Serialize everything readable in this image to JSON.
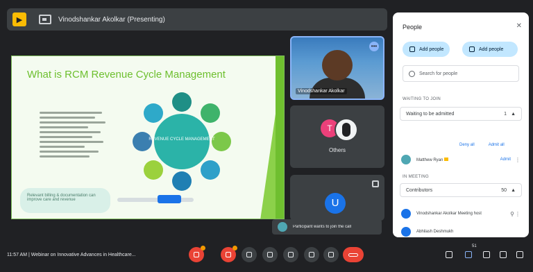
{
  "header": {
    "presenter": "Vinodshankar Akolkar (Presenting)"
  },
  "slide": {
    "title": "What is RCM Revenue Cycle Management",
    "center_label": "REVENUE CYCLE MANAGEMENT",
    "callout_text": "Relevant billing & documentation can improve care and revenue"
  },
  "tiles": {
    "video_name": "Vinodshankar Akolkar",
    "group_label": "Others",
    "avatar_letter_a": "T",
    "avatar_letter_u": "U"
  },
  "toast": {
    "text": "Participant wants to join the call"
  },
  "panel": {
    "title": "People",
    "add_people": "Add people",
    "add_people2": "Add people",
    "search_placeholder": "Search for people",
    "waiting_label": "WAITING TO JOIN",
    "waiting_dropdown": "Waiting to be admitted",
    "waiting_count": "1",
    "deny_all": "Deny all",
    "admit_all": "Admit all",
    "waiting_person": "Matthew Ryan",
    "admit_label": "Admit",
    "in_meeting_label": "IN MEETING",
    "contributors_dropdown": "Contributors",
    "contributors_count": "50",
    "person_1": "Vinodshankar Akolkar Meeting host",
    "person_2": "Abhilash Deshmukh"
  },
  "bottombar": {
    "meeting_info": "11:57 AM  |  Webinar on Innovative Advances in Healthcare...",
    "people_count": "51"
  },
  "colors": {
    "accent": "#1a73e8",
    "danger": "#ea4335",
    "slide_green": "#6dbf2e"
  }
}
